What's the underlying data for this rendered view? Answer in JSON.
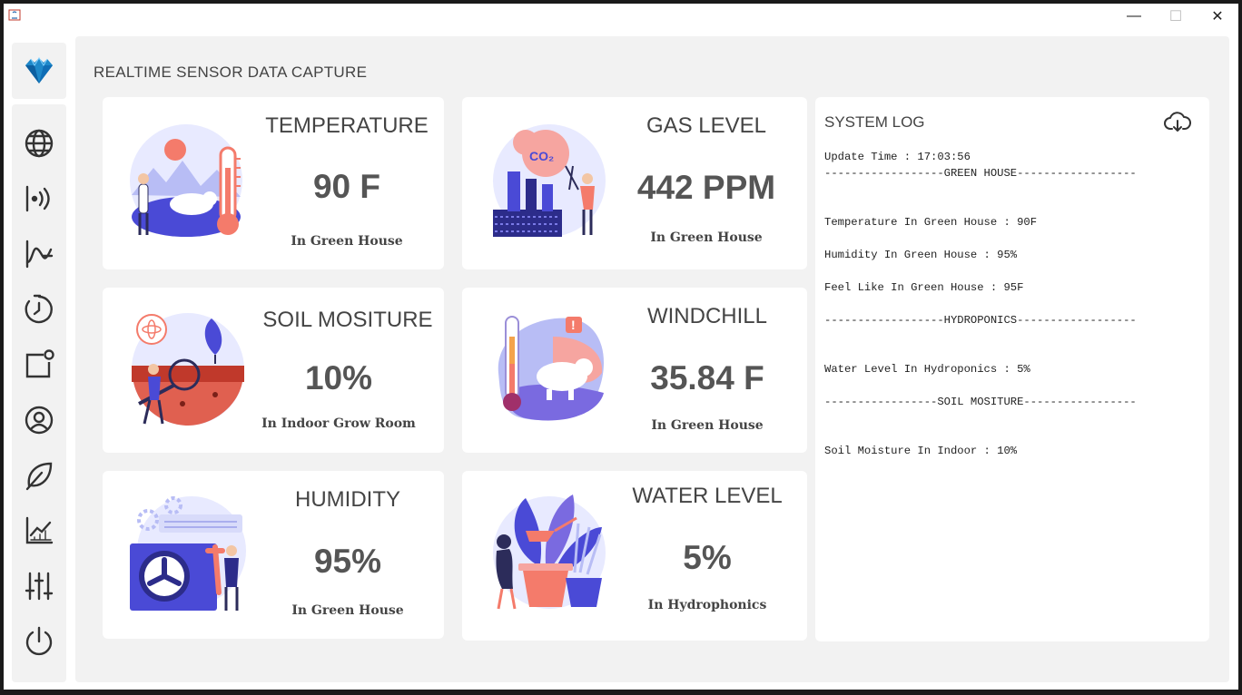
{
  "header": {
    "title": "REALTIME SENSOR DATA CAPTURE"
  },
  "window_controls": {
    "minimize": "—",
    "maximize": "☐",
    "close": "✕"
  },
  "sidebar": {
    "items": [
      {
        "name": "globe-icon"
      },
      {
        "name": "signal-icon"
      },
      {
        "name": "wave-graph-icon"
      },
      {
        "name": "clock-icon"
      },
      {
        "name": "notification-icon"
      },
      {
        "name": "user-circle-icon"
      },
      {
        "name": "leaf-icon"
      },
      {
        "name": "chart-icon"
      },
      {
        "name": "sliders-icon"
      },
      {
        "name": "power-icon"
      }
    ]
  },
  "cards": {
    "temperature": {
      "title": "TEMPERATURE",
      "value": "90 F",
      "location": "In Green House"
    },
    "gas": {
      "title": "GAS LEVEL",
      "value": "442 PPM",
      "location": "In Green House"
    },
    "soil": {
      "title": "SOIL MOSITURE",
      "value": "10%",
      "location": "In Indoor Grow Room"
    },
    "windchill": {
      "title": "WINDCHILL",
      "value": "35.84 F",
      "location": "In Green House"
    },
    "humidity": {
      "title": "HUMIDITY",
      "value": "95%",
      "location": "In Green House"
    },
    "water": {
      "title": "WATER LEVEL",
      "value": "5%",
      "location": "In Hydrophonics"
    }
  },
  "system_log": {
    "title": "SYSTEM LOG",
    "lines": [
      "Update Time : 17:03:56",
      "------------------GREEN HOUSE------------------",
      "",
      "",
      "Temperature In Green House : 90F",
      "",
      "Humidity In Green House : 95%",
      "",
      "Feel Like In Green House : 95F",
      "",
      "------------------HYDROPONICS------------------",
      "",
      "",
      "Water Level In Hydroponics : 5%",
      "",
      "-----------------SOIL MOSITURE-----------------",
      "",
      "",
      "Soil Moisture In Indoor : 10%"
    ]
  },
  "colors": {
    "accent": "#4a4ad6",
    "coral": "#f47b6b",
    "panel_bg": "#f2f2f2",
    "card_bg": "#ffffff"
  }
}
